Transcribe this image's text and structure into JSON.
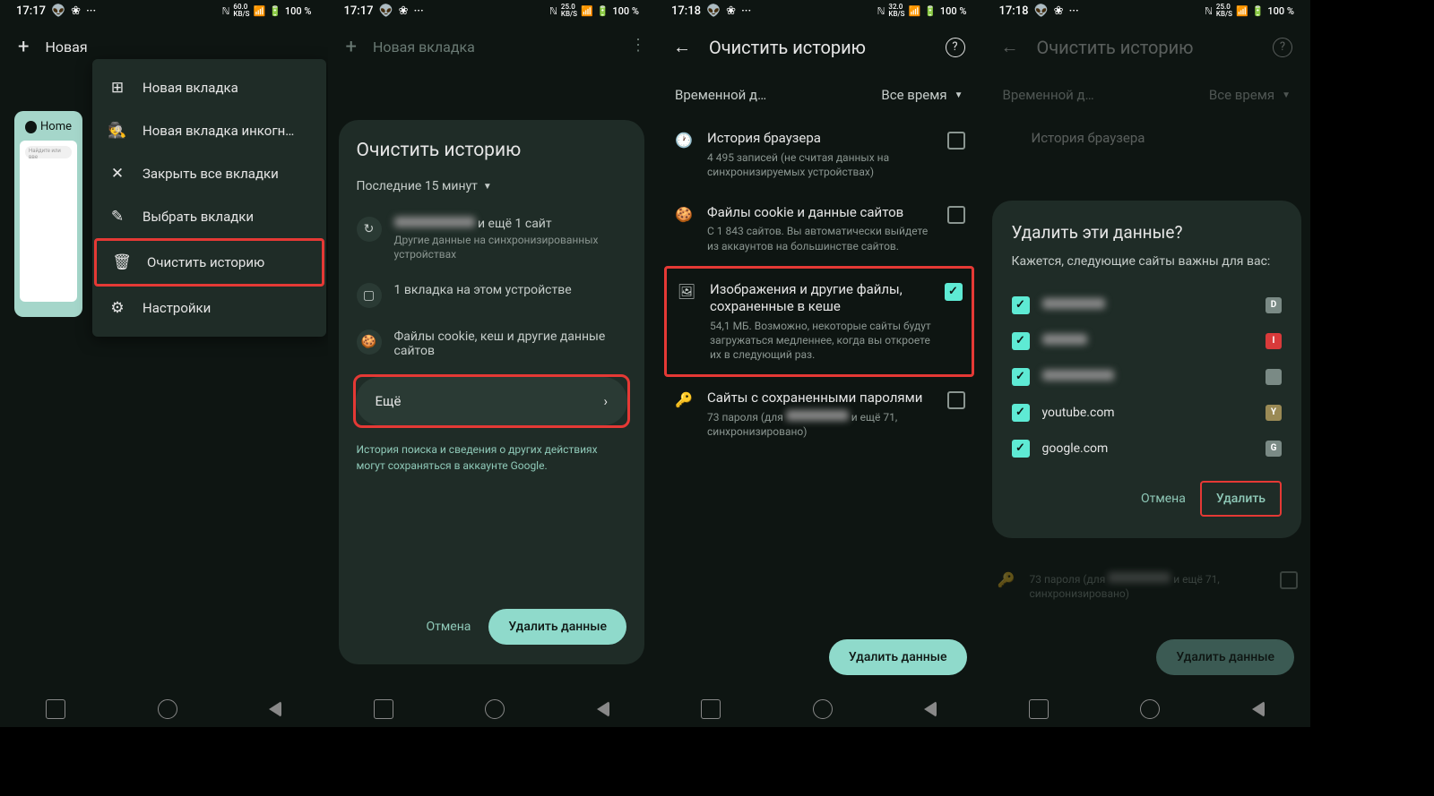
{
  "status": {
    "times": [
      "17:17",
      "17:17",
      "17:18",
      "17:18"
    ],
    "nets": [
      "60.0",
      "25.0",
      "32.0",
      "25.0"
    ],
    "net_unit": "KB/S",
    "battery": "100 %"
  },
  "p1": {
    "header_plus": "+",
    "header_title": "Новая",
    "tab_label": "Home",
    "tab_search": "Найдите или вве",
    "menu": [
      {
        "ico": "⊞",
        "label": "Новая вкладка"
      },
      {
        "ico": "🕵",
        "label": "Новая вкладка инкогн…"
      },
      {
        "ico": "✕",
        "label": "Закрыть все вкладки"
      },
      {
        "ico": "✎",
        "label": "Выбрать вкладки"
      },
      {
        "ico": "🗑",
        "label": "Очистить историю",
        "hl": true
      },
      {
        "ico": "⚙",
        "label": "Настройки"
      }
    ]
  },
  "p2": {
    "header_title": "Новая вкладка",
    "sheet_title": "Очистить историю",
    "dropdown": "Последние 15 минут",
    "items": [
      {
        "ico": "↻",
        "title": "████████ и ещё 1 сайт",
        "sub": "Другие данные на синхронизированных устройствах",
        "blur": true
      },
      {
        "ico": "▢",
        "title": "1 вкладка на этом устройстве",
        "sub": ""
      },
      {
        "ico": "🍪",
        "title": "Файлы cookie, кеш и другие данные сайтов",
        "sub": ""
      }
    ],
    "more": "Ещё",
    "foot": "История поиска и сведения о других действиях могут сохраняться в аккаунте Google.",
    "cancel": "Отмена",
    "primary": "Удалить данные"
  },
  "p3": {
    "title": "Очистить историю",
    "range_label": "Временной д…",
    "range_value": "Все время",
    "rows": [
      {
        "ico": "🕐",
        "t": "История браузера",
        "s": "4 495 записей (не считая данных на синхронизируемых устройствах)",
        "cb": false
      },
      {
        "ico": "🍪",
        "t": "Файлы cookie и данные сайтов",
        "s": "С 1 843 сайтов. Вы автоматически выйдете из аккаунтов на большинстве сайтов.",
        "cb": false
      },
      {
        "ico": "🖼",
        "t": "Изображения и другие файлы, сохраненные в кеше",
        "s": "54,1 МБ. Возможно, некоторые сайты будут загружаться медленнее, когда вы откроете их в следующий раз.",
        "cb": true,
        "hl": true
      },
      {
        "ico": "🔑",
        "t": "Сайты с сохраненными паролями",
        "s": "73 пароля (для ████████ и ещё 71, синхронизировано)",
        "cb": false,
        "blur": true
      }
    ],
    "btn": "Удалить данные"
  },
  "p4": {
    "title": "Очистить историю",
    "range_label": "Временной д…",
    "range_value": "Все время",
    "bg_title": "История браузера",
    "bg_pass": "73 пароля (для ████████ и ещё 71, синхронизировано)",
    "dlg_title": "Удалить эти данные?",
    "dlg_sub": "Кажется, следующие сайты важны для вас:",
    "sites": [
      {
        "name": "████████",
        "badge": "D",
        "bc": "#7a8a85",
        "blur": true
      },
      {
        "name": "██████",
        "badge": "I",
        "bc": "#d93a3a",
        "blur": true
      },
      {
        "name": "████████",
        "badge": "",
        "bc": "#7a8a85",
        "blur": true
      },
      {
        "name": "youtube.com",
        "badge": "Y",
        "bc": "#9a8a55"
      },
      {
        "name": "google.com",
        "badge": "G",
        "bc": "#7a8a85"
      }
    ],
    "cancel": "Отмена",
    "delete": "Удалить",
    "btn": "Удалить данные"
  }
}
